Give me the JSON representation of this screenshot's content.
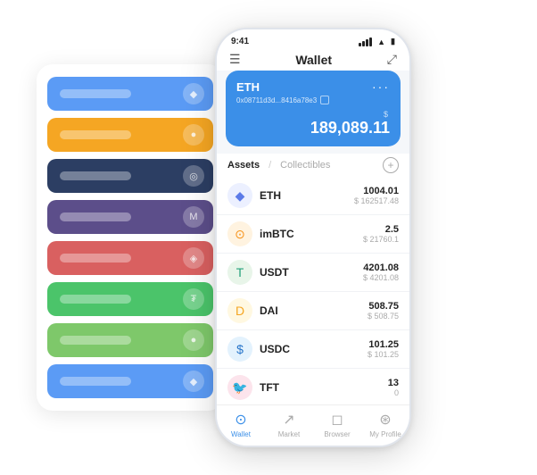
{
  "statusBar": {
    "time": "9:41",
    "battery": "▮",
    "wifi": "wifi"
  },
  "navBar": {
    "menuIcon": "☰",
    "title": "Wallet",
    "expandIcon": "⤢"
  },
  "ethCard": {
    "title": "ETH",
    "dotsLabel": "···",
    "address": "0x08711d3d...8416a78e3",
    "copyIcon": "",
    "balanceLabel": "$",
    "balance": "189,089.11"
  },
  "assetsSection": {
    "tabAssets": "Assets",
    "slash": "/",
    "tabCollectibles": "Collectibles",
    "addLabel": "+"
  },
  "assetList": [
    {
      "symbol": "ETH",
      "iconEmoji": "◆",
      "iconBg": "#ECF0FF",
      "iconColor": "#5C7BE8",
      "amount": "1004.01",
      "usdAmount": "$ 162517.48"
    },
    {
      "symbol": "imBTC",
      "iconEmoji": "◎",
      "iconBg": "#FFF3E0",
      "iconColor": "#F7931A",
      "amount": "2.5",
      "usdAmount": "$ 21760.1"
    },
    {
      "symbol": "USDT",
      "iconEmoji": "₮",
      "iconBg": "#E8F5E9",
      "iconColor": "#26A17B",
      "amount": "4201.08",
      "usdAmount": "$ 4201.08"
    },
    {
      "symbol": "DAI",
      "iconEmoji": "◈",
      "iconBg": "#FFF8E1",
      "iconColor": "#F5A623",
      "amount": "508.75",
      "usdAmount": "$ 508.75"
    },
    {
      "symbol": "USDC",
      "iconEmoji": "$",
      "iconBg": "#E3F2FD",
      "iconColor": "#2775CA",
      "amount": "101.25",
      "usdAmount": "$ 101.25"
    },
    {
      "symbol": "TFT",
      "iconEmoji": "✿",
      "iconBg": "#FCE4EC",
      "iconColor": "#E91E63",
      "amount": "13",
      "usdAmount": "0"
    }
  ],
  "bottomNav": [
    {
      "icon": "⊙",
      "label": "Wallet",
      "active": true
    },
    {
      "icon": "📈",
      "label": "Market",
      "active": false
    },
    {
      "icon": "◻",
      "label": "Browser",
      "active": false
    },
    {
      "icon": "👤",
      "label": "My Profile",
      "active": false
    }
  ],
  "cardStack": [
    {
      "color": "#5B9BF5",
      "iconText": "◆"
    },
    {
      "color": "#F5A623",
      "iconText": "●"
    },
    {
      "color": "#2C3E63",
      "iconText": "◎"
    },
    {
      "color": "#5C4E8A",
      "iconText": "M"
    },
    {
      "color": "#D96060",
      "iconText": "◈"
    },
    {
      "color": "#4BC46A",
      "iconText": "₮"
    },
    {
      "color": "#7EC86A",
      "iconText": "●"
    },
    {
      "color": "#5B9BF5",
      "iconText": "◆"
    }
  ]
}
